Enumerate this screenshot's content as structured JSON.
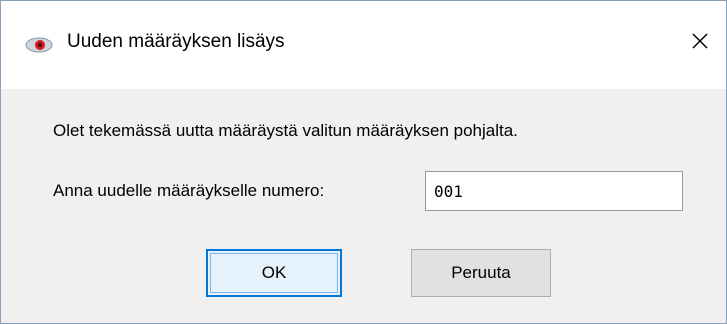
{
  "window": {
    "title": "Uuden määräyksen lisäys",
    "app_icon": "eye-icon",
    "close_icon": "close-icon"
  },
  "dialog": {
    "message": "Olet tekemässä uutta määräystä valitun määräyksen pohjalta.",
    "number_label": "Anna uudelle määräykselle numero:",
    "number_value": "001"
  },
  "buttons": {
    "ok_label": "OK",
    "cancel_label": "Peruuta"
  },
  "colors": {
    "focus_accent": "#0078d7",
    "dialog_background": "#f0f0f0",
    "titlebar_background": "#ffffff"
  }
}
